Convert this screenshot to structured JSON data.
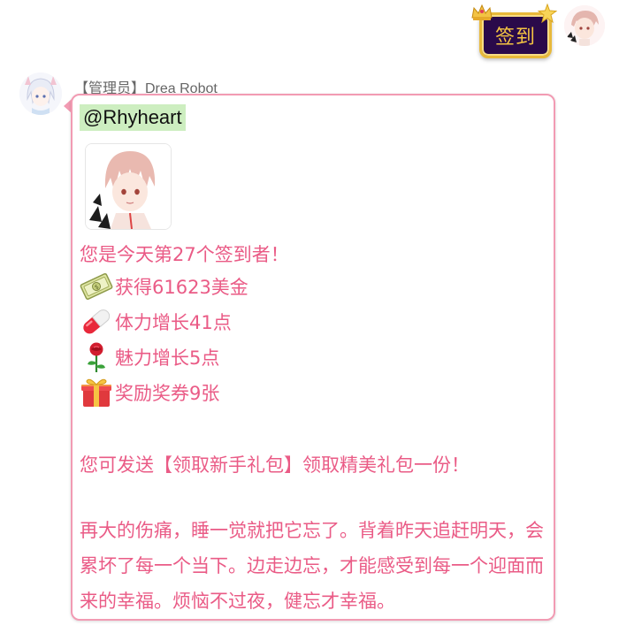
{
  "outgoing": {
    "message": "签到"
  },
  "incoming": {
    "sender": "【管理员】Drea Robot",
    "mention": "@Rhyheart",
    "rank_line": "您是今天第27个签到者！",
    "rewards": [
      {
        "icon": "money-icon",
        "text": "获得61623美金"
      },
      {
        "icon": "pill-icon",
        "text": "体力增长41点"
      },
      {
        "icon": "rose-icon",
        "text": "魅力增长5点"
      },
      {
        "icon": "gift-icon",
        "text": "奖励奖券9张"
      }
    ],
    "gift_pack_line": "您可发送【领取新手礼包】领取精美礼包一份！",
    "quote": "再大的伤痛，睡一觉就把它忘了。背着昨天追赶明天，会累坏了每一个当下。边走边忘，才能感受到每一个迎面而来的幸福。烦恼不过夜，健忘才幸福。"
  },
  "colors": {
    "bubble_border": "#f29bb3",
    "message_text": "#ea5b86",
    "mention_bg": "#cdeec0",
    "checkin_bg": "#2a0a4a",
    "checkin_text": "#f5c542"
  }
}
